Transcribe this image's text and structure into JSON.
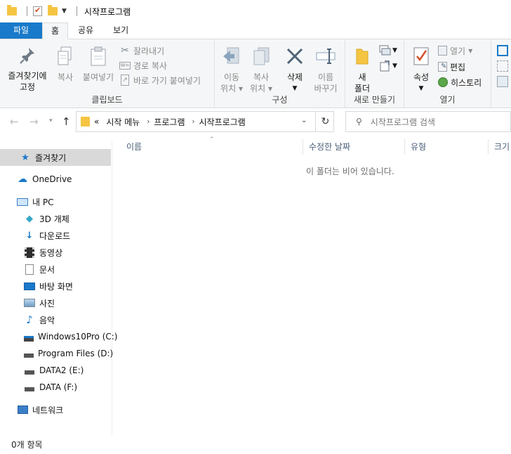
{
  "window": {
    "title": "시작프로그램"
  },
  "tabs": [
    {
      "label": "파일"
    },
    {
      "label": "홈"
    },
    {
      "label": "공유"
    },
    {
      "label": "보기"
    }
  ],
  "ribbon": {
    "clipboard": {
      "group_label": "클립보드",
      "pin_label_1": "즐겨찾기에",
      "pin_label_2": "고정",
      "copy_label": "복사",
      "paste_label": "붙여넣기",
      "cut_label": "잘라내기",
      "copy_path_label": "경로 복사",
      "paste_shortcut_label": "바로 가기 붙여넣기"
    },
    "organize": {
      "group_label": "구성",
      "move_label_1": "이동",
      "move_label_2": "위치",
      "copyto_label_1": "복사",
      "copyto_label_2": "위치",
      "delete_label": "삭제",
      "rename_label_1": "이름",
      "rename_label_2": "바꾸기"
    },
    "new": {
      "group_label": "새로 만들기",
      "new_folder_label_1": "새",
      "new_folder_label_2": "폴더"
    },
    "open": {
      "group_label": "열기",
      "properties_label": "속성",
      "open_label": "열기",
      "edit_label": "편집",
      "history_label": "히스토리"
    }
  },
  "address": {
    "overflow": "«",
    "crumbs": [
      "시작 메뉴",
      "프로그램",
      "시작프로그램"
    ]
  },
  "search": {
    "placeholder": "시작프로그램 검색"
  },
  "nav": {
    "quick_access": "즐겨찾기",
    "onedrive": "OneDrive",
    "this_pc": "내 PC",
    "items": [
      "3D 개체",
      "다운로드",
      "동영상",
      "문서",
      "바탕 화면",
      "사진",
      "음악",
      "Windows10Pro (C:)",
      "Program Files (D:)",
      "DATA2 (E:)",
      "DATA (F:)"
    ],
    "network": "네트워크"
  },
  "columns": [
    "이름",
    "수정한 날짜",
    "유형",
    "크기"
  ],
  "empty_message": "이 폴더는 비어 있습니다.",
  "status": {
    "item_count": "0개 항목"
  },
  "colors": {
    "file_tab": "#1979ca",
    "folder": "#f5c542",
    "accent": "#0078d7"
  }
}
